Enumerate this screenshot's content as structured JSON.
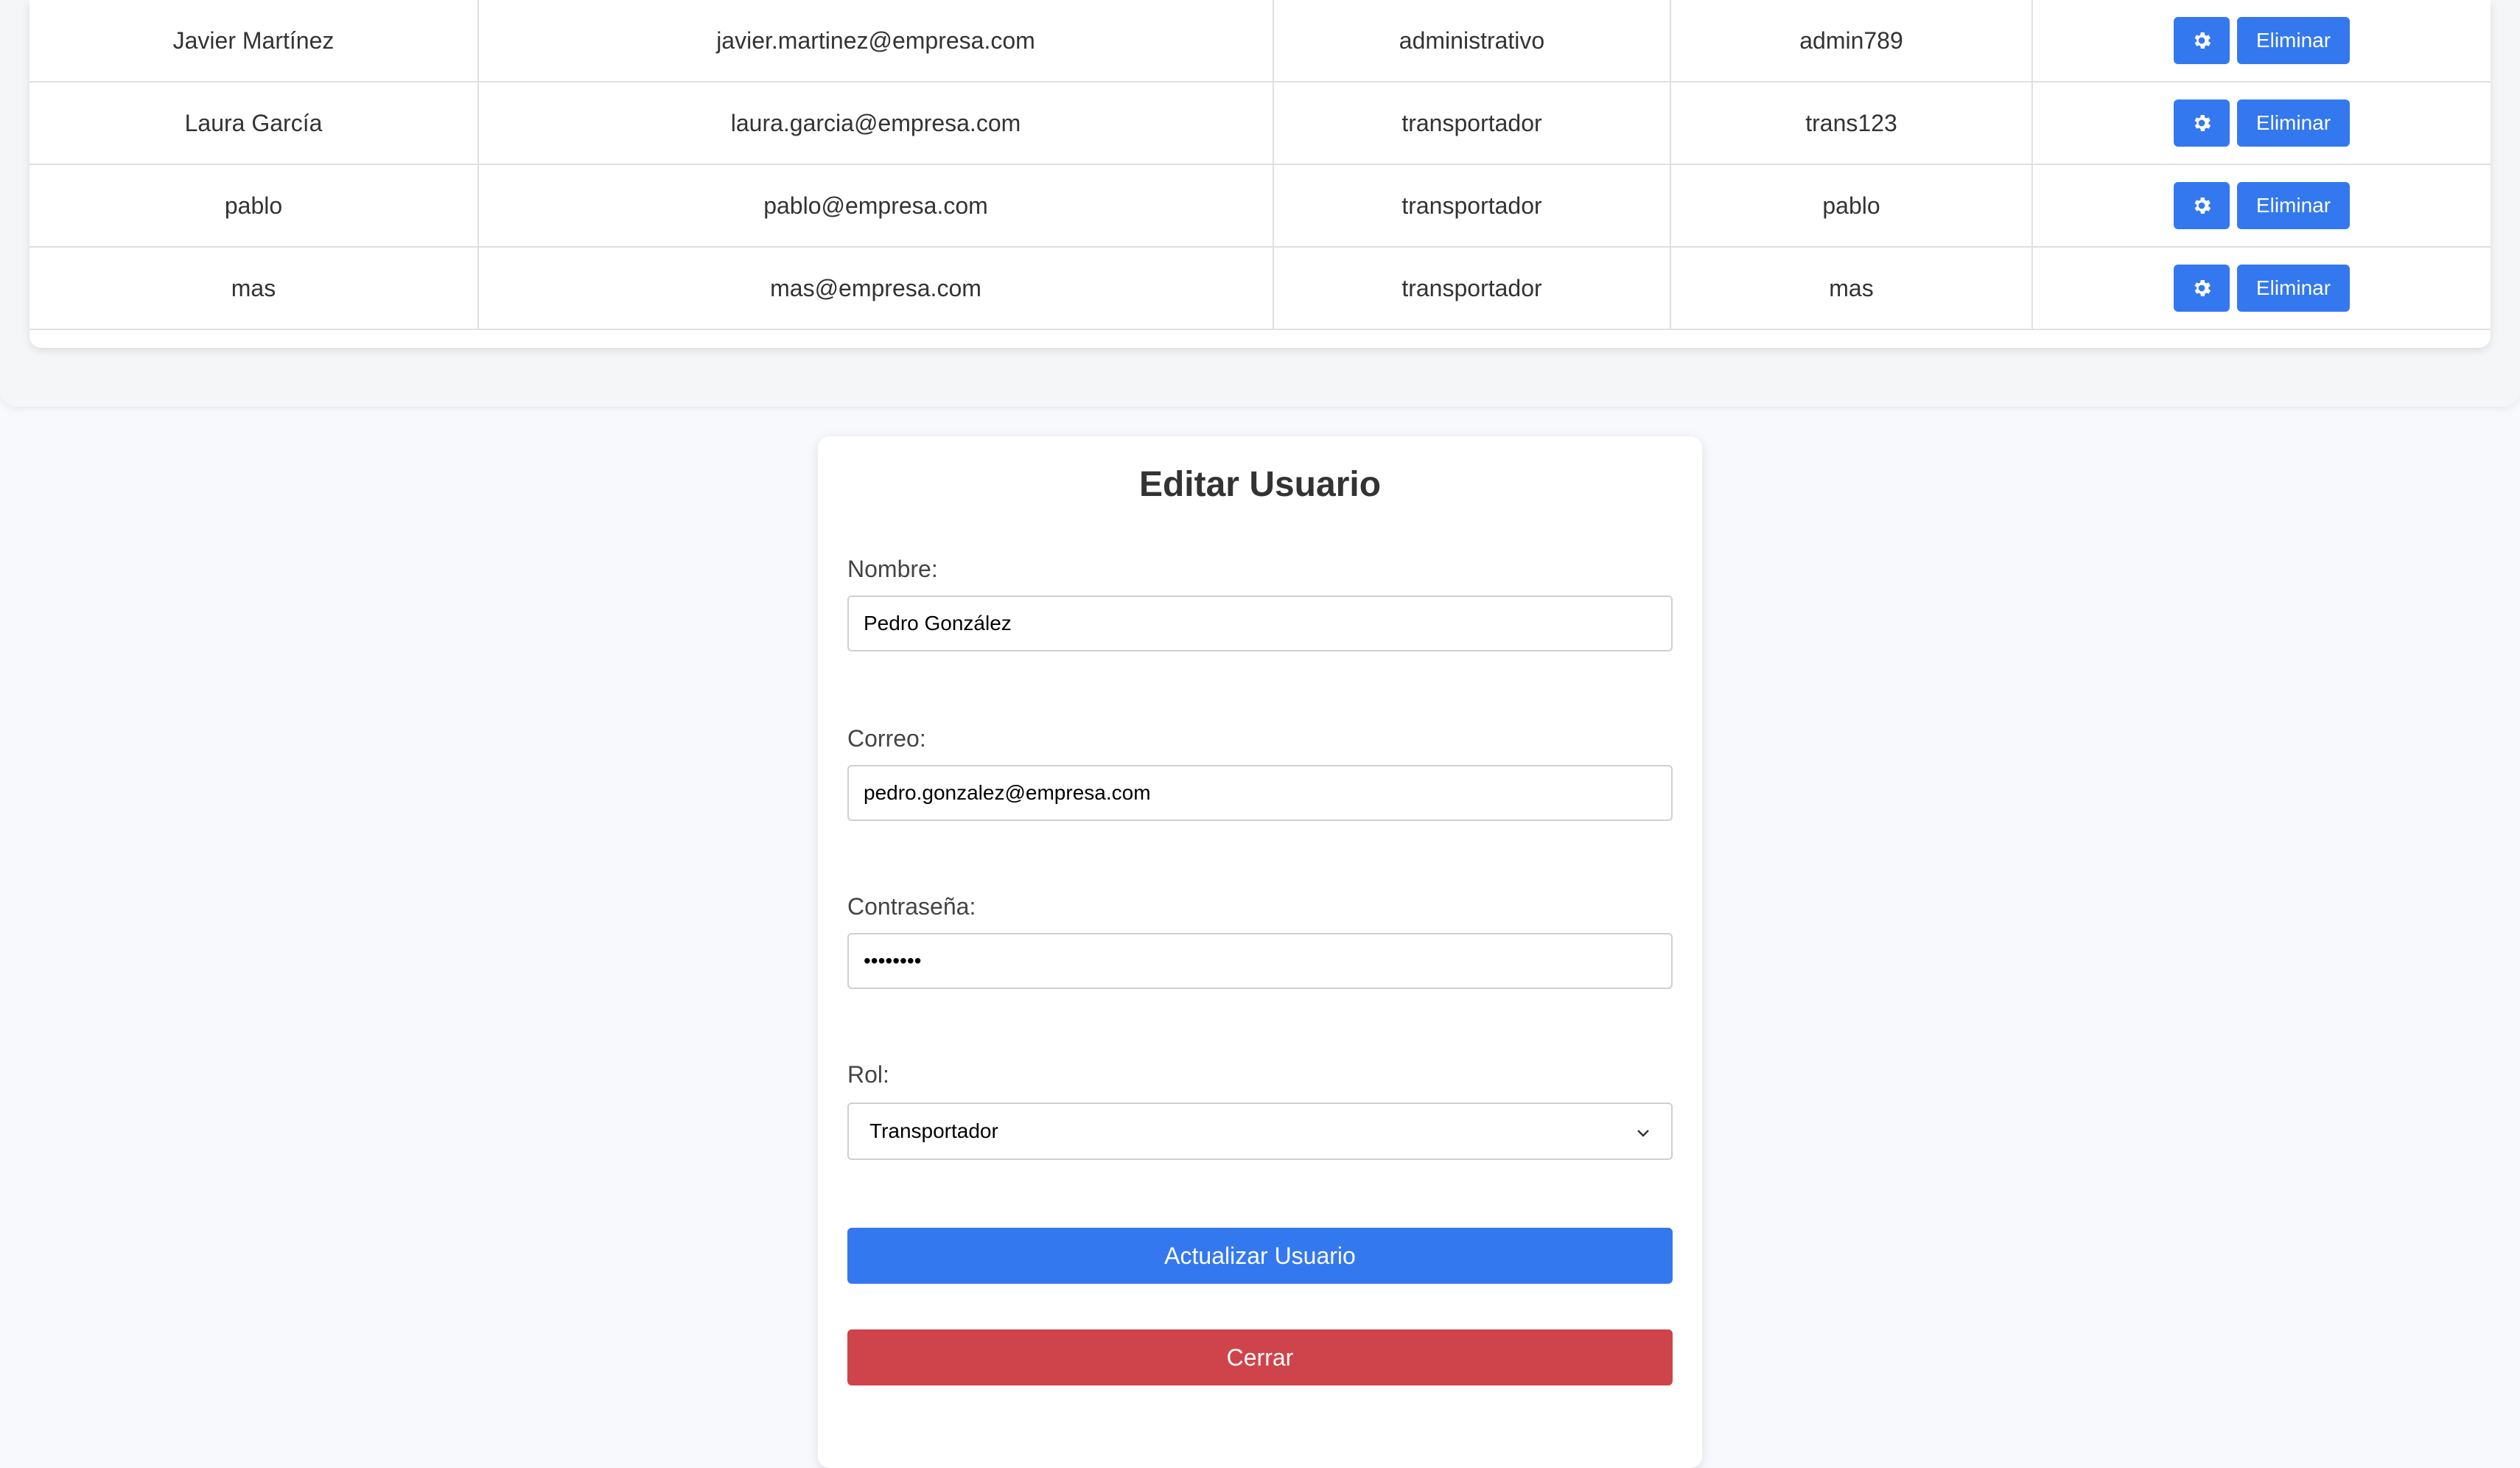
{
  "users_table": {
    "rows": [
      {
        "name": "Javier Martínez",
        "email": "javier.martinez@empresa.com",
        "role": "administrativo",
        "password": "admin789",
        "delete_label": "Eliminar"
      },
      {
        "name": "Laura García",
        "email": "laura.garcia@empresa.com",
        "role": "transportador",
        "password": "trans123",
        "delete_label": "Eliminar"
      },
      {
        "name": "pablo",
        "email": "pablo@empresa.com",
        "role": "transportador",
        "password": "pablo",
        "delete_label": "Eliminar"
      },
      {
        "name": "mas",
        "email": "mas@empresa.com",
        "role": "transportador",
        "password": "mas",
        "delete_label": "Eliminar"
      }
    ],
    "edit_icon": "gear-icon"
  },
  "edit_form": {
    "title": "Editar Usuario",
    "name_label": "Nombre:",
    "name_value": "Pedro González",
    "email_label": "Correo:",
    "email_value": "pedro.gonzalez@empresa.com",
    "password_label": "Contraseña:",
    "password_value": "••••••••",
    "role_label": "Rol:",
    "role_selected": "Transportador",
    "update_button": "Actualizar Usuario",
    "close_button": "Cerrar"
  },
  "colors": {
    "primary": "#3478f0",
    "danger": "#cf434a",
    "background": "#f7f9fc"
  }
}
